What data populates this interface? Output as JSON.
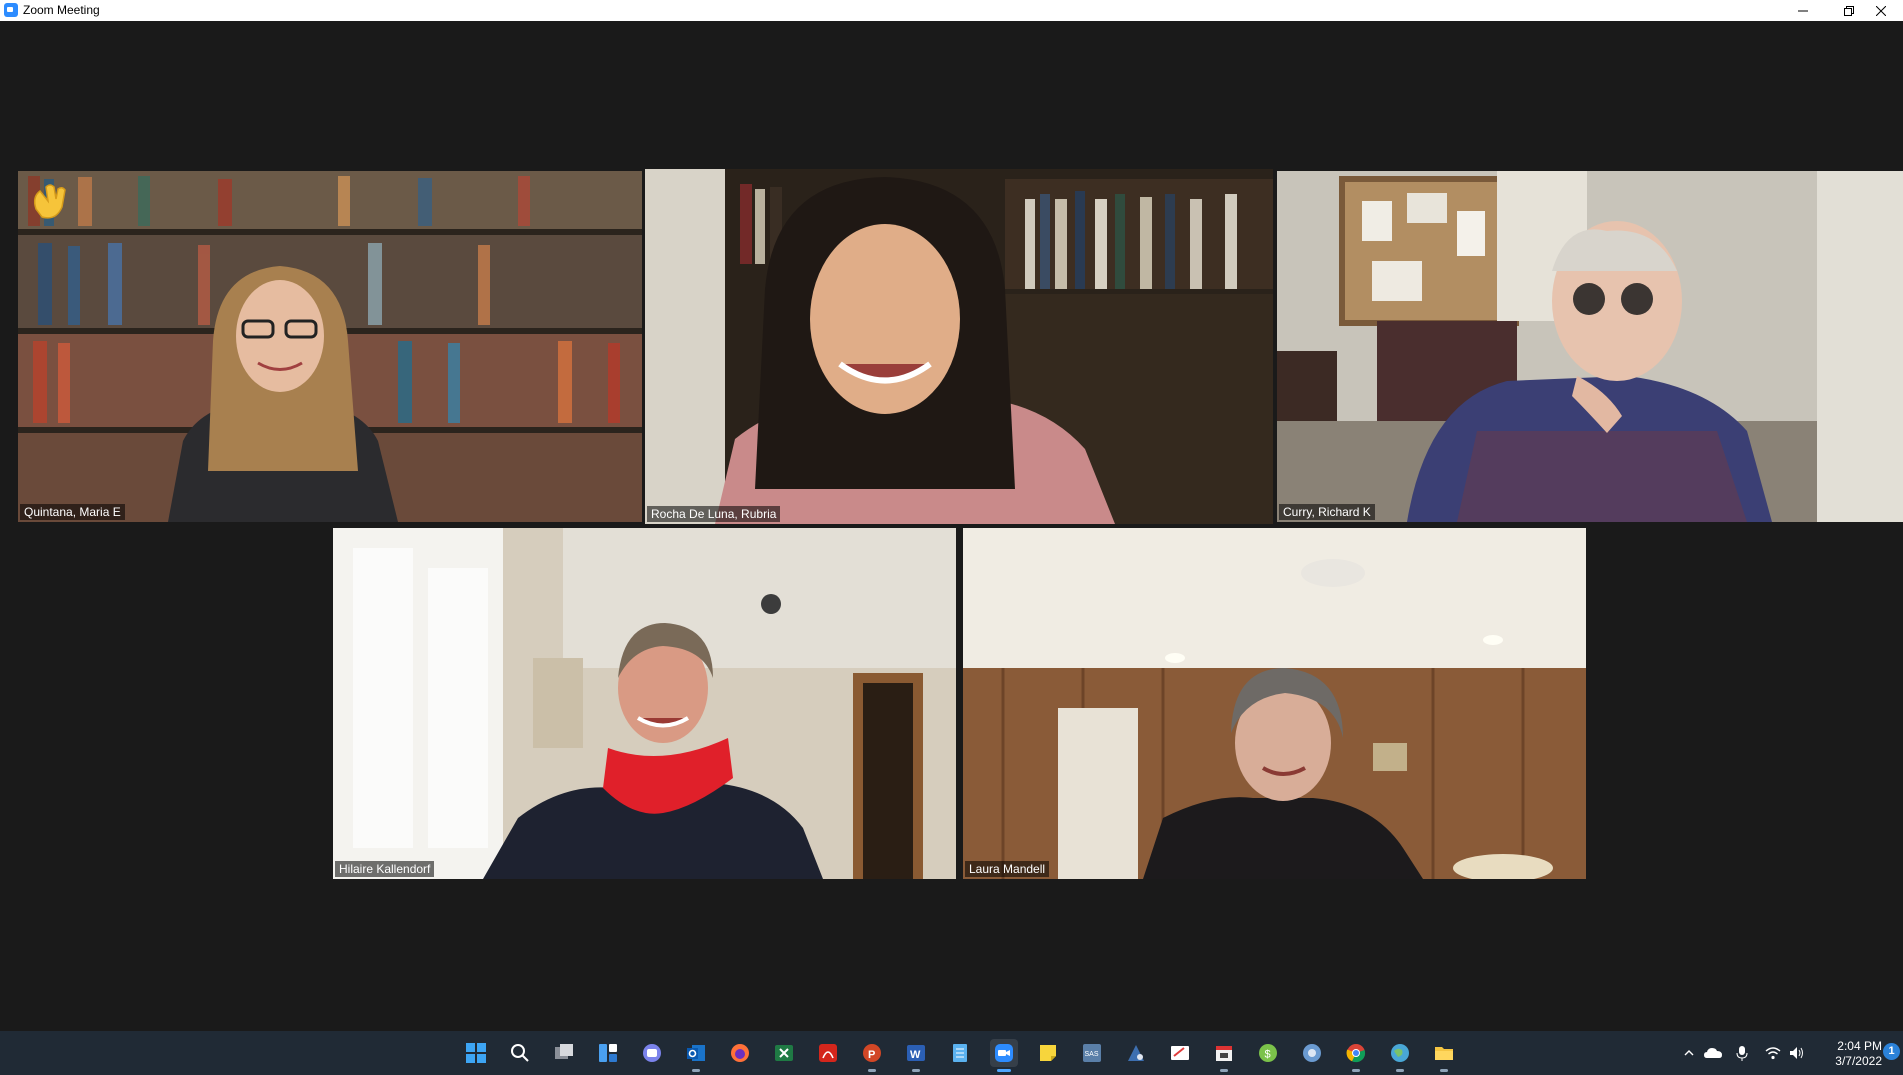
{
  "window": {
    "title": "Zoom Meeting",
    "controls": [
      "minimize-icon",
      "restore-icon",
      "close-icon"
    ]
  },
  "participants": [
    {
      "name": "Quintana, Maria E",
      "reaction": "waving-hand-icon",
      "active_speaker": false
    },
    {
      "name": "Rocha De Luna, Rubria",
      "active_speaker": true
    },
    {
      "name": "Curry, Richard K",
      "active_speaker": false
    },
    {
      "name": "Hilaire Kallendorf",
      "active_speaker": false
    },
    {
      "name": "Laura Mandell",
      "active_speaker": false
    }
  ],
  "colors": {
    "meeting_bg": "#1a1a1a",
    "active_speaker_border": "#d6e85a",
    "taskbar_bg": "#202a35"
  },
  "taskbar": {
    "apps": [
      "start-icon",
      "search-icon",
      "task-view-icon",
      "widgets-icon",
      "teams-chat-icon",
      "outlook-icon",
      "firefox-icon",
      "excel-icon",
      "acrobat-icon",
      "powerpoint-icon",
      "word-icon",
      "notepad-icon",
      "zoom-icon",
      "sticky-notes-icon",
      "sas-icon",
      "sas-viya-icon",
      "whiteboard-icon",
      "calendar-app-icon",
      "money-app-icon",
      "network-app-icon",
      "chrome-icon",
      "globe-app-icon",
      "file-explorer-icon"
    ],
    "tray": [
      "chevron-up-icon",
      "onedrive-icon",
      "microphone-icon",
      "wifi-icon",
      "volume-icon"
    ],
    "clock": {
      "time": "2:04 PM",
      "date": "3/7/2022"
    },
    "notification_count": "1"
  }
}
